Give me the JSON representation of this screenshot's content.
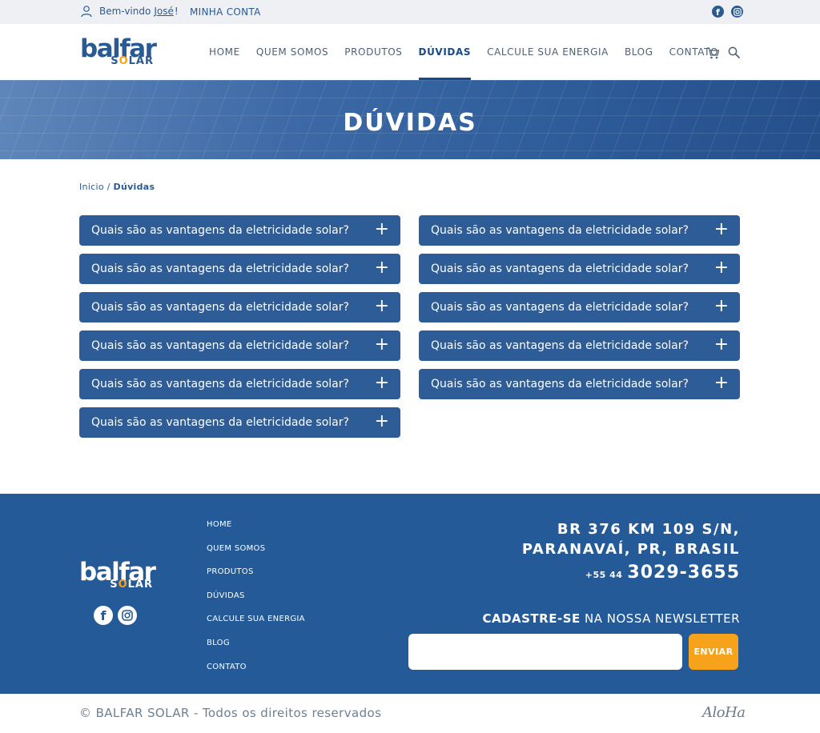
{
  "topbar": {
    "greeting": "Bem-vindo",
    "user_name": "José",
    "exclaim": "!",
    "account_link": "MINHA CONTA",
    "social_icons": [
      "facebook-icon",
      "instagram-icon"
    ]
  },
  "header": {
    "logo_word": "balfar",
    "logo_sub_before": "S",
    "logo_sub_o": "O",
    "logo_sub_after": "LAR",
    "nav": [
      {
        "label": "HOME",
        "active": false
      },
      {
        "label": "QUEM SOMOS",
        "active": false
      },
      {
        "label": "PRODUTOS",
        "active": false
      },
      {
        "label": "DÚVIDAS",
        "active": true
      },
      {
        "label": "CALCULE SUA ENERGIA",
        "active": false
      },
      {
        "label": "BLOG",
        "active": false
      },
      {
        "label": "CONTATO",
        "active": false
      }
    ],
    "icons": [
      "cart-icon",
      "search-icon"
    ]
  },
  "banner": {
    "title": "DÚVIDAS"
  },
  "breadcrumb": {
    "home": "Inicio",
    "separator": "/",
    "current": "Dúvidas"
  },
  "faq": {
    "left": [
      "Quais são as vantagens da eletricidade solar?",
      "Quais são as vantagens da eletricidade solar?",
      "Quais são as vantagens da eletricidade solar?",
      "Quais são as vantagens da eletricidade solar?",
      "Quais são as vantagens da eletricidade solar?",
      "Quais são as vantagens da eletricidade solar?"
    ],
    "right": [
      "Quais são as vantagens da eletricidade solar?",
      "Quais são as vantagens da eletricidade solar?",
      "Quais são as vantagens da eletricidade solar?",
      "Quais são as vantagens da eletricidade solar?",
      "Quais são as vantagens da eletricidade solar?"
    ],
    "expand_symbol": "+"
  },
  "footer": {
    "nav": [
      "HOME",
      "QUEM SOMOS",
      "PRODUTOS",
      "DÚVIDAS",
      "CALCULE SUA ENERGIA",
      "BLOG",
      "CONTATO"
    ],
    "address_line1": "BR 376 KM 109 S/N,",
    "address_line2": "PARANAVAÍ, PR,  BRASIL",
    "phone_country": "+55 44",
    "phone_number": "3029-3655",
    "newsletter_bold": "CADASTRE-SE",
    "newsletter_rest": " NA NOSSA NEWSLETTER",
    "email_placeholder": "",
    "send_label": "ENVIAR"
  },
  "bottom": {
    "copyright": "© BALFAR SOLAR - Todos os direitos reservados",
    "credit": "AloHa"
  },
  "colors": {
    "primary": "#2a5a94",
    "footer_bg": "#245a97",
    "accent": "#f7a21b",
    "topbar_bg": "#eef0f3"
  }
}
